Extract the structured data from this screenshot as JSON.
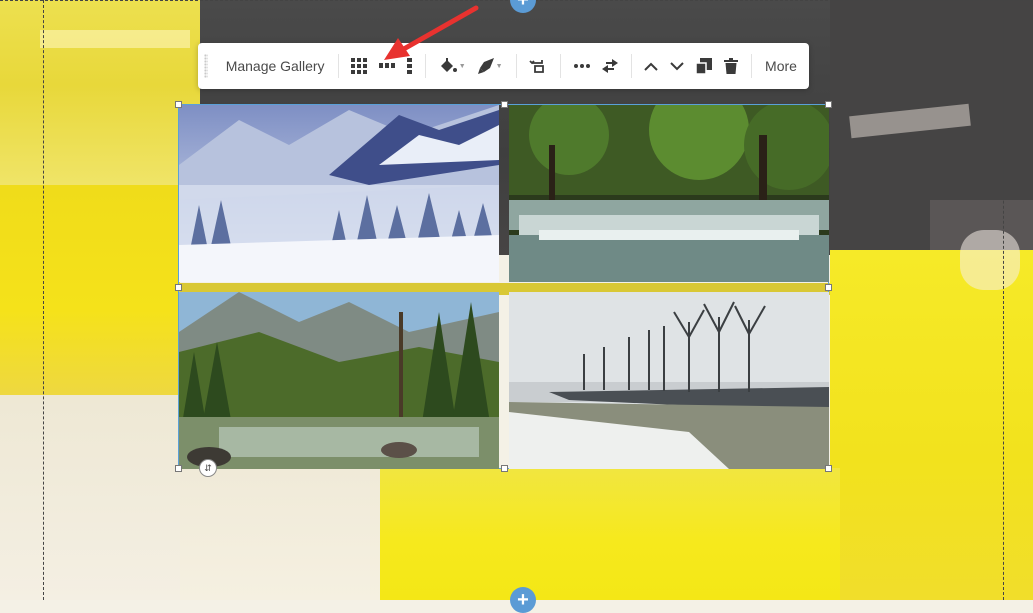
{
  "toolbar": {
    "manage_gallery_label": "Manage Gallery",
    "more_label": "More",
    "icons": [
      "grid-layout-icon",
      "row-layout-icon",
      "column-layout-icon",
      "paint-bucket-icon",
      "rocket-icon",
      "style-copy-icon",
      "spacing-icon",
      "swap-icon",
      "chevron-up-icon",
      "chevron-down-icon",
      "duplicate-icon",
      "trash-icon"
    ]
  },
  "gallery": {
    "images": [
      "snowy-mountains-forest",
      "forest-waterfall",
      "mountain-river-valley",
      "frosty-road-trees"
    ]
  },
  "colors": {
    "accent": "#5b9bd5",
    "annotation_arrow": "#e8322f",
    "selection_border": "#5aa0d8"
  }
}
